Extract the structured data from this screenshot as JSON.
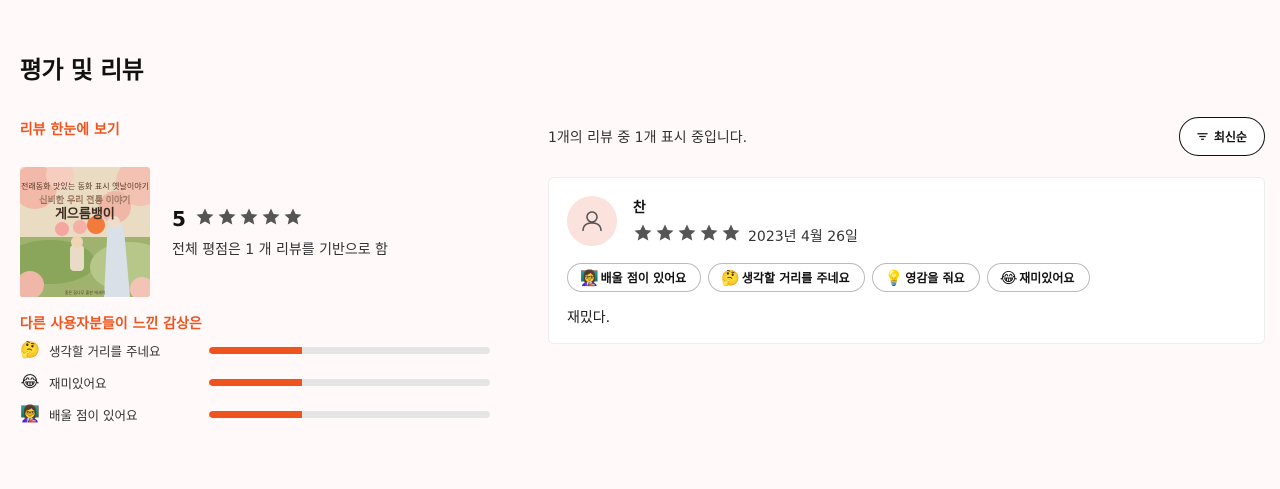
{
  "page": {
    "title": "평가 및 리뷰",
    "accent_color": "#f0541e"
  },
  "summary": {
    "overview_label": "리뷰 한눈에 보기",
    "book_cover": {
      "line1": "전래동화 맛있는 동화 표시 옛날이야기",
      "line2": "신비한 우리 전통 이야기",
      "line3": "게으름뱅이",
      "publisher": "좋은 꿈나무 출판 에세이"
    },
    "score": "5",
    "rating": 5,
    "based_on": "전체 평점은 1 개 리뷰를 기반으로 함"
  },
  "feelings": {
    "label": "다른 사용자분들이 느낀 감상은",
    "items": [
      {
        "emoji": "🤔",
        "label": "생각할 거리를 주네요",
        "fraction": 0.33
      },
      {
        "emoji": "😂",
        "label": "재미있어요",
        "fraction": 0.33
      },
      {
        "emoji": "👩‍🏫",
        "label": "배울 점이 있어요",
        "fraction": 0.33
      }
    ]
  },
  "reviews": {
    "count_text": "1개의 리뷰 중 1개 표시 중입니다.",
    "sort_label": "최신순",
    "sort_icon": "filter-icon",
    "items": [
      {
        "avatar_icon": "user-icon",
        "name": "찬",
        "rating": 5,
        "date": "2023년 4월 26일",
        "chips": [
          {
            "emoji": "👩‍🏫",
            "label": "배울 점이 있어요"
          },
          {
            "emoji": "🤔",
            "label": "생각할 거리를 주네요"
          },
          {
            "emoji": "💡",
            "label": "영감을 줘요"
          },
          {
            "emoji": "😂",
            "label": "재미있어요"
          }
        ],
        "body": "재밌다."
      }
    ]
  },
  "colors": {
    "star": "#555555",
    "bar_track": "#e5e5e5",
    "avatar_bg": "#fbe2dc"
  }
}
